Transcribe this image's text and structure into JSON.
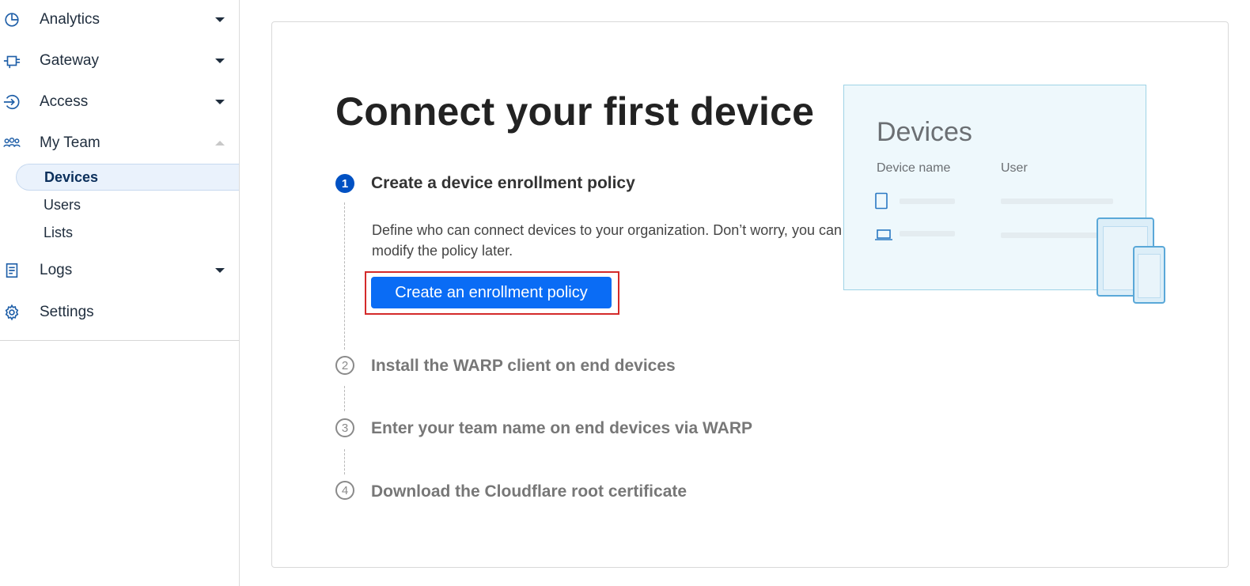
{
  "sidebar": {
    "items": [
      {
        "label": "Analytics",
        "icon": "pie-chart-icon"
      },
      {
        "label": "Gateway",
        "icon": "gateway-icon"
      },
      {
        "label": "Access",
        "icon": "access-icon"
      },
      {
        "label": "My Team",
        "icon": "team-icon"
      },
      {
        "label": "Logs",
        "icon": "logs-icon"
      },
      {
        "label": "Settings",
        "icon": "gear-icon"
      }
    ],
    "my_team_sub": [
      {
        "label": "Devices",
        "active": true
      },
      {
        "label": "Users",
        "active": false
      },
      {
        "label": "Lists",
        "active": false
      }
    ]
  },
  "main": {
    "title": "Connect your first device",
    "steps": [
      {
        "number": "1",
        "title": "Create a device enrollment policy",
        "active": true
      },
      {
        "number": "2",
        "title": "Install the WARP client on end devices",
        "active": false
      },
      {
        "number": "3",
        "title": "Enter your team name on end devices via WARP",
        "active": false
      },
      {
        "number": "4",
        "title": "Download the Cloudflare root certificate",
        "active": false
      }
    ],
    "step1_description": "Define who can connect devices to your organization. Don’t worry, you can modify the policy later.",
    "create_button_label": "Create an enrollment policy"
  },
  "illustration": {
    "title": "Devices",
    "col_device_name": "Device name",
    "col_user": "User"
  },
  "colors": {
    "primary": "#0a6cf5",
    "step_active": "#0051c3",
    "highlight_border": "#d42a2a",
    "sidebar_active_bg": "#eaf2fc"
  }
}
